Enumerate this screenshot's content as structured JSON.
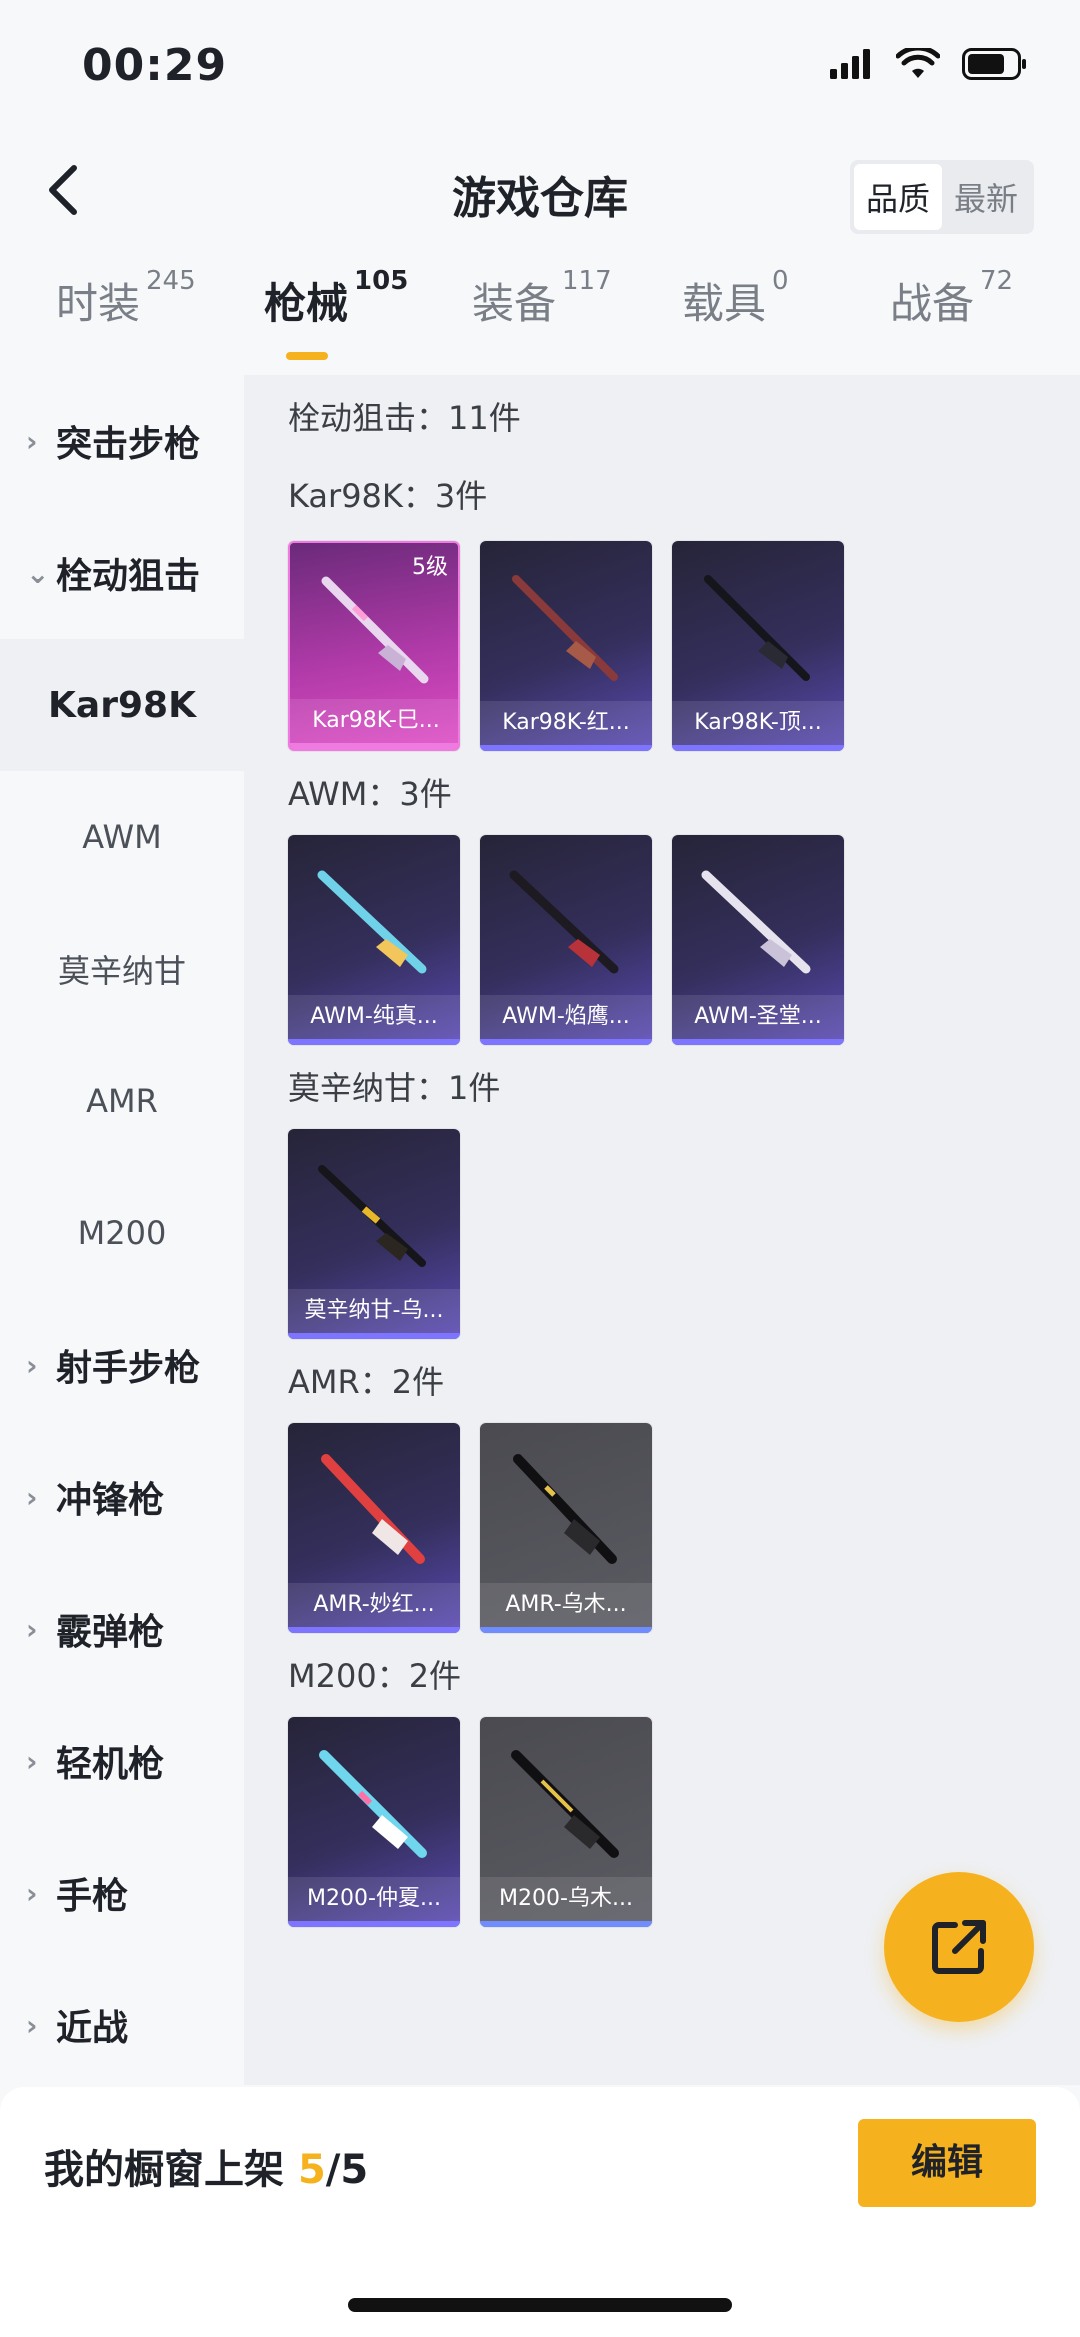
{
  "status_bar": {
    "time": "00:29"
  },
  "header": {
    "title": "游戏仓库",
    "sort": [
      "品质",
      "最新"
    ]
  },
  "tabs": [
    {
      "label": "时装",
      "count": "245"
    },
    {
      "label": "枪械",
      "count": "105"
    },
    {
      "label": "装备",
      "count": "117"
    },
    {
      "label": "载具",
      "count": "0"
    },
    {
      "label": "战备",
      "count": "72"
    }
  ],
  "sidebar": {
    "items": [
      {
        "label": "突击步枪",
        "type": "category"
      },
      {
        "label": "栓动狙击",
        "type": "category-expanded"
      },
      {
        "label": "Kar98K",
        "type": "sub-active"
      },
      {
        "label": "AWM",
        "type": "sub"
      },
      {
        "label": "莫辛纳甘",
        "type": "sub"
      },
      {
        "label": "AMR",
        "type": "sub"
      },
      {
        "label": "M200",
        "type": "sub"
      },
      {
        "label": "射手步枪",
        "type": "category"
      },
      {
        "label": "冲锋枪",
        "type": "category"
      },
      {
        "label": "霰弹枪",
        "type": "category"
      },
      {
        "label": "轻机枪",
        "type": "category"
      },
      {
        "label": "手枪",
        "type": "category"
      },
      {
        "label": "近战",
        "type": "category"
      }
    ]
  },
  "content": {
    "summary": "栓动狙击：11件",
    "groups": [
      {
        "title": "Kar98K：3件",
        "items": [
          {
            "name": "Kar98K-巳...",
            "level": "5级",
            "style": "pink"
          },
          {
            "name": "Kar98K-红...",
            "style": "purple"
          },
          {
            "name": "Kar98K-顶...",
            "style": "purple"
          }
        ]
      },
      {
        "title": "AWM：3件",
        "items": [
          {
            "name": "AWM-纯真...",
            "style": "purple"
          },
          {
            "name": "AWM-焰鹰...",
            "style": "purple"
          },
          {
            "name": "AWM-圣堂...",
            "style": "purple"
          }
        ]
      },
      {
        "title": "莫辛纳甘：1件",
        "items": [
          {
            "name": "莫辛纳甘-乌...",
            "style": "purple"
          }
        ]
      },
      {
        "title": "AMR：2件",
        "items": [
          {
            "name": "AMR-妙红...",
            "style": "purple"
          },
          {
            "name": "AMR-乌木...",
            "style": "grey"
          }
        ]
      },
      {
        "title": "M200：2件",
        "items": [
          {
            "name": "M200-仲夏...",
            "style": "purple"
          },
          {
            "name": "M200-乌木...",
            "style": "grey"
          }
        ]
      }
    ]
  },
  "bottom": {
    "label": "我的橱窗上架",
    "current": "5",
    "total": "/5",
    "edit": "编辑"
  },
  "colors": {
    "accent": "#f5b21e",
    "rare_purple": "#5a4ab4",
    "legendary_pink": "#e04dc6"
  },
  "icons": {
    "back": "chevron-left-icon",
    "share": "external-link-icon"
  }
}
